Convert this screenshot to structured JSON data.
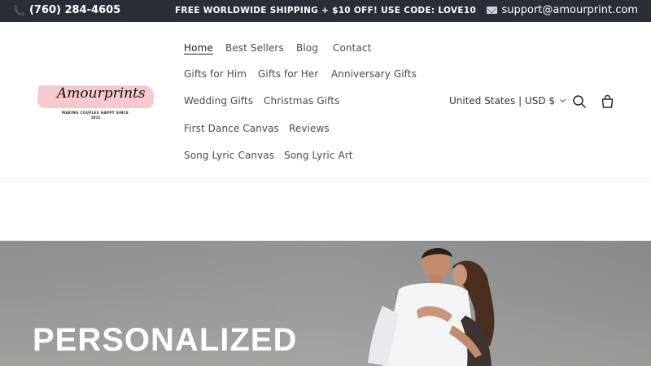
{
  "announcement": {
    "phone": "(760) 284-4605",
    "promo": "FREE WORLDWIDE SHIPPING + $10 OFF! USE CODE: LOVE10",
    "email": "support@amourprint.com"
  },
  "logo": {
    "brand": "Amourprints",
    "tagline": "MAKING COUPLES HAPPY SINCE",
    "year": "2012"
  },
  "nav": {
    "items": [
      {
        "label": "Home",
        "active": true
      },
      {
        "label": "Best Sellers"
      },
      {
        "label": "Blog"
      },
      {
        "label": "Contact"
      },
      {
        "label": "Gifts for Him"
      },
      {
        "label": "Gifts for Her"
      },
      {
        "label": "Anniversary Gifts"
      },
      {
        "label": "Wedding Gifts"
      },
      {
        "label": "Christmas Gifts"
      },
      {
        "label": "First Dance Canvas"
      },
      {
        "label": "Reviews"
      },
      {
        "label": "Song Lyric Canvas"
      },
      {
        "label": "Song Lyric Art"
      }
    ]
  },
  "localization": {
    "label": "United States | USD $"
  },
  "icons": {
    "phone": "phone-icon",
    "email": "email-icon",
    "search": "search-icon",
    "cart": "cart-icon"
  },
  "hero": {
    "title": "PERSONALIZED"
  },
  "colors": {
    "topbar_bg": "#2a2f37",
    "logo_brush": "#f6c9cd",
    "hero_bg": "#949596"
  }
}
